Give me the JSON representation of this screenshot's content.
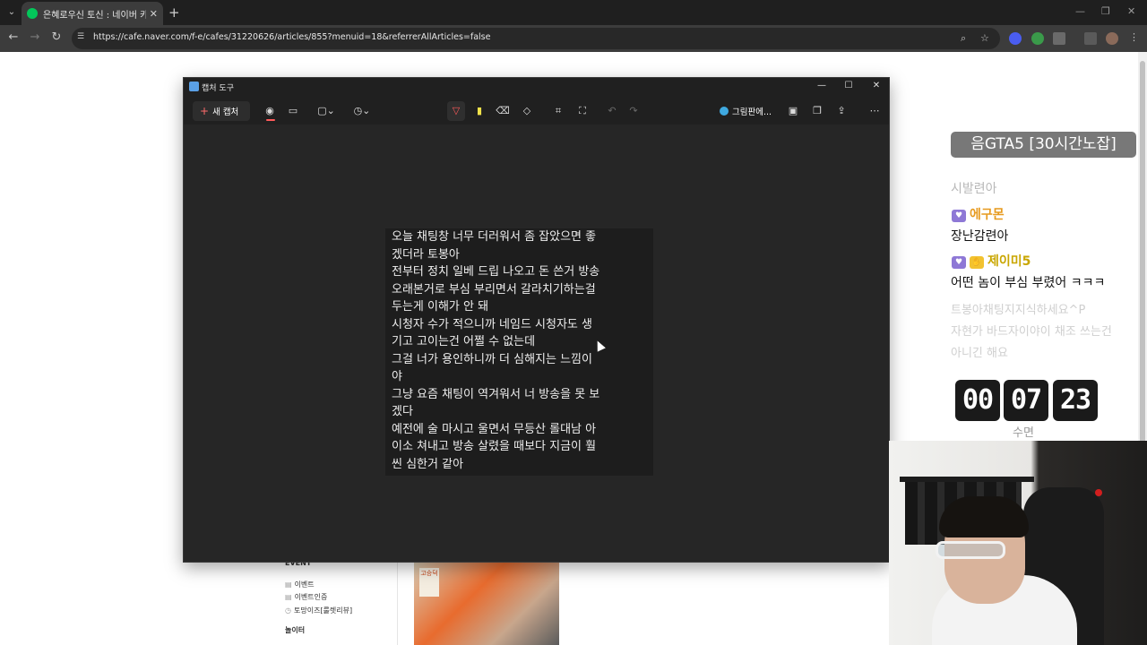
{
  "browser": {
    "tab_title": "은혜로우신 토신 : 네이버 카페",
    "new_tab": "+",
    "url": "https://cafe.naver.com/f-e/cafes/31220626/articles/855?menuid=18&referrerAllArticles=false"
  },
  "page": {
    "menu_section": "EVENT",
    "menu_items": [
      "이벤트",
      "이벤트인증",
      "토망이즈[룰렛리뷰]"
    ],
    "menu_section2": "놀이터",
    "post_image_caption": "고승덕"
  },
  "snipping_tool": {
    "title": "캡처 도구",
    "new_capture_label": "새 캡처",
    "open_in_paint_label": "그림판에...",
    "captured_chat": [
      "오늘 채팅창 너무 더러워서 좀 잡았으면 좋",
      "겠더라 토봉아",
      "전부터 정치 일베 드립 나오고 돈 쓴거 방송",
      "오래본거로 부심 부리면서 갈라치기하는걸",
      "두는게 이해가 안 돼",
      "시청자 수가 적으니까 네임드 시청자도 생",
      "기고 고이는건 어쩔 수 없는데",
      "그걸 너가 용인하니까 더 심해지는 느낌이",
      "야",
      "그냥 요즘 채팅이 역겨워서 너 방송을 못 보",
      "겠다",
      "예전에 술 마시고 울면서 무등산 롤대남 아",
      "이소 쳐내고 방송 살렸을 때보다 지금이 훨",
      "씬 심한거 같아"
    ]
  },
  "stream_overlay": {
    "title": "음GTA5 [30시간노잡]",
    "chat_faded": "시발련아",
    "chat": [
      {
        "name": "에구몬",
        "message": "장난감련아",
        "badge_color": "#8e78d6",
        "name_color": "#e79a1e"
      },
      {
        "name": "제이미5",
        "message": "어떤 놈이 부심 부렸어 ㅋㅋㅋ",
        "badge_color": "#8e78d6",
        "name_color": "#c9a600"
      }
    ],
    "chat_ghost": [
      "트봉아채팅지지식하세요^P",
      "자현가 바드자이야이 채조 쓰는건",
      "아니긴 해요"
    ],
    "timer": {
      "hours": "00",
      "minutes": "07",
      "seconds": "23",
      "label": "수면"
    }
  },
  "colors": {
    "browser_dark": "#1f1f1f",
    "toolbar": "#3c3c3c",
    "snip_bg": "#202020",
    "accent_red": "#ff5a5a",
    "naver_green": "#03c75a"
  }
}
